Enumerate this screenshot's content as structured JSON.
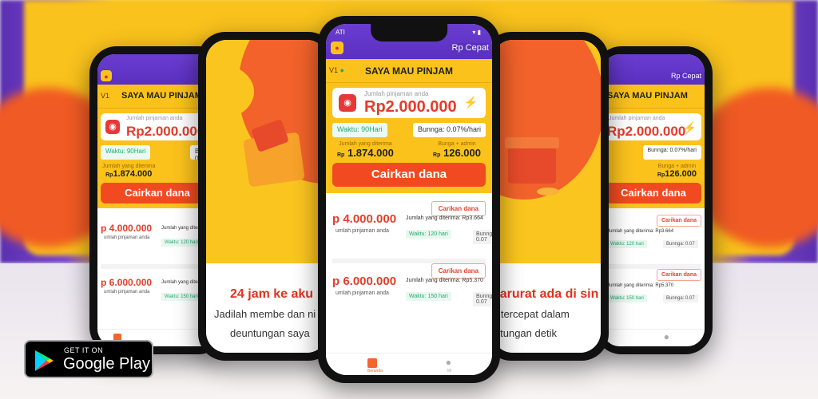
{
  "store_badge": {
    "small": "GET IT ON",
    "big": "Google Play"
  },
  "app": {
    "brand": "Rp Cepat",
    "status_left": "ATI",
    "title": "SAYA MAU PINJAM",
    "vip": "V1",
    "amount_label": "Jumlah pinjaman anda",
    "amount": "Rp2.000.000",
    "term": "Waktu: 90Hari",
    "interest": "Bunnga: 0.07%/hari",
    "received_label": "Jumlah yang diterima",
    "received_prefix": "Rp",
    "received": "1.874.000",
    "fee_label": "Bunga + admin",
    "fee_prefix": "Rp",
    "fee": "126.000",
    "cta": "Cairkan dana",
    "cards": [
      {
        "amount": "p 4.000.000",
        "sub": "umlah pinjaman anda",
        "button": "Carikan dana",
        "received": "Jumlah yang diterima: Rp3.664",
        "term": "Waktu: 120 hari",
        "interest": "Bunnga: 0.07"
      },
      {
        "amount": "p 6.000.000",
        "sub": "umlah pinjaman anda",
        "button": "Carikan dana",
        "received": "Jumlah yang diterima: Rp5.370",
        "term": "Waktu: 150 hari",
        "interest": "Bunnga: 0.07"
      }
    ],
    "tab_home": "Beranda",
    "tab_me": "Mi"
  },
  "promo_left": {
    "title": "24 jam ke aku",
    "line1": "Jadilah membe dan ni",
    "line2": "deuntungan saya"
  },
  "promo_right": {
    "title": "darurat ada di sin",
    "line1": "a tercepat dalam",
    "line2": "hitungan detik"
  },
  "colors": {
    "yellow": "#fbc21c",
    "orange": "#f14a20",
    "purple": "#5b30c0",
    "red": "#e43c2a"
  }
}
